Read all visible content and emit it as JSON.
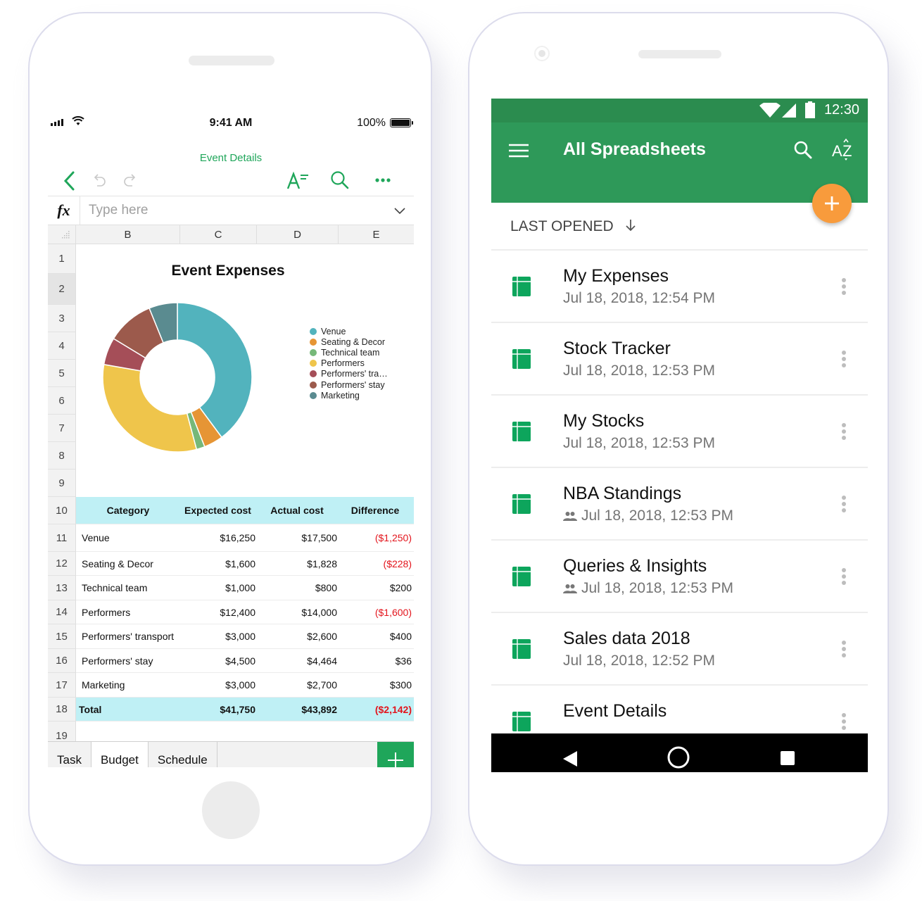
{
  "ios": {
    "status": {
      "time": "9:41 AM",
      "battery": "100%"
    },
    "title": "Event Details",
    "toolbar": {
      "back": "back-icon",
      "undo": "undo-icon",
      "redo": "redo-icon",
      "format": "text-format-icon",
      "search": "search-icon",
      "more": "more-icon"
    },
    "formula": {
      "fx": "fx",
      "placeholder": "Type here",
      "value": ""
    },
    "columns": [
      "B",
      "C",
      "D",
      "E"
    ],
    "rows": [
      "1",
      "2",
      "3",
      "4",
      "5",
      "6",
      "7",
      "8",
      "9",
      "10",
      "11",
      "12",
      "13",
      "14",
      "15",
      "16",
      "17",
      "18",
      "19"
    ],
    "table": {
      "headers": [
        "Category",
        "Expected cost",
        "Actual cost",
        "Difference"
      ],
      "rows": [
        [
          "Venue",
          "$16,250",
          "$17,500",
          "($1,250)"
        ],
        [
          "Seating & Decor",
          "$1,600",
          "$1,828",
          "($228)"
        ],
        [
          "Technical team",
          "$1,000",
          "$800",
          "$200"
        ],
        [
          "Performers",
          "$12,400",
          "$14,000",
          "($1,600)"
        ],
        [
          "Performers' transport",
          "$3,000",
          "$2,600",
          "$400"
        ],
        [
          "Performers' stay",
          "$4,500",
          "$4,464",
          "$36"
        ],
        [
          "Marketing",
          "$3,000",
          "$2,700",
          "$300"
        ]
      ],
      "total": [
        "Total",
        "$41,750",
        "$43,892",
        "($2,142)"
      ]
    },
    "sheet_tabs": [
      "Task",
      "Budget",
      "Schedule"
    ],
    "active_tab": "Budget",
    "colors": {
      "accent": "#1fa65a",
      "header_fill": "#bff0f5",
      "negative": "#e3141c"
    }
  },
  "chart_data": {
    "type": "pie",
    "variant": "donut",
    "title": "Event Expenses",
    "categories": [
      "Venue",
      "Seating & Decor",
      "Technical team",
      "Performers",
      "Performers' transport",
      "Performers' stay",
      "Marketing"
    ],
    "legend_labels": [
      "Venue",
      "Seating & Decor",
      "Technical team",
      "Performers",
      "Performers' tra…",
      "Performers' stay",
      "Marketing"
    ],
    "values": [
      17500,
      1828,
      800,
      14000,
      2600,
      4464,
      2700
    ],
    "colors": [
      "#52b3bd",
      "#e69535",
      "#76b879",
      "#efc54b",
      "#a54e58",
      "#9c5a4c",
      "#5a8b90"
    ],
    "legend": "right"
  },
  "android": {
    "status": {
      "time": "12:30"
    },
    "appbar": {
      "title": "All Spreadsheets",
      "menu": "menu-icon",
      "search": "search-icon",
      "sort": "sort-az-icon"
    },
    "sort_label": "LAST OPENED",
    "files": [
      {
        "name": "My Expenses",
        "date": "Jul 18, 2018, 12:54 PM",
        "shared": false
      },
      {
        "name": "Stock Tracker",
        "date": "Jul 18, 2018, 12:53 PM",
        "shared": false
      },
      {
        "name": "My Stocks",
        "date": "Jul 18, 2018, 12:53 PM",
        "shared": false
      },
      {
        "name": "NBA Standings",
        "date": "Jul 18, 2018, 12:53 PM",
        "shared": true
      },
      {
        "name": "Queries & Insights",
        "date": "Jul 18, 2018, 12:53 PM",
        "shared": true
      },
      {
        "name": "Sales data 2018",
        "date": "Jul 18, 2018, 12:52 PM",
        "shared": false
      },
      {
        "name": "Event Details",
        "date": "",
        "shared": false
      }
    ],
    "colors": {
      "status_bar": "#2b8c4f",
      "app_bar": "#2e9959",
      "fab": "#f89b3c",
      "sheet_icon": "#0da55c"
    }
  }
}
